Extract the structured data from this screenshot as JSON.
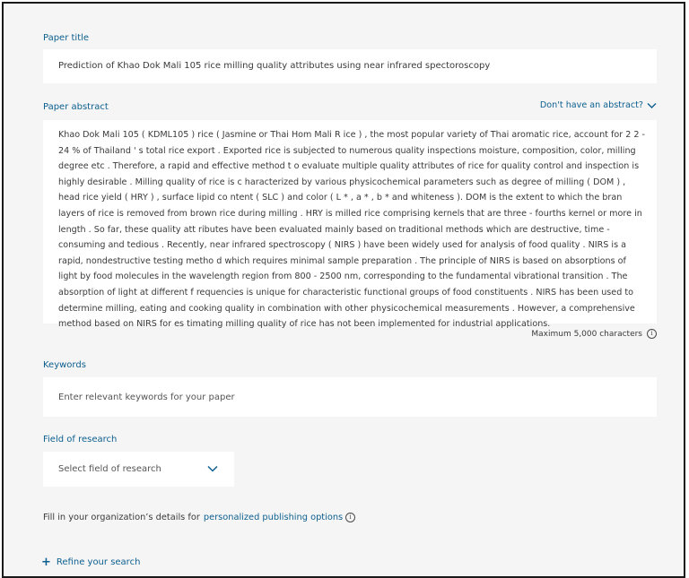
{
  "title_section": {
    "label": "Paper title",
    "value": "Prediction of Khao Dok Mali 105 rice milling quality attributes using near infrared spectoroscopy"
  },
  "abstract_section": {
    "label": "Paper abstract",
    "no_abstract_link": "Don't have an abstract?",
    "value": "Khao Dok Mali 105 ( KDML105 ) rice ( Jasmine or Thai Hom Mali R ice ) , the most popular variety of Thai aromatic rice, account for 2 2 - 24 % of Thailand ' s total rice export . Exported rice is subjected to numerous quality inspections moisture, composition, color, milling degree etc . Therefore, a rapid and effective method t o evaluate multiple quality attributes of rice for quality control and inspection is highly desirable . Milling quality of rice is c haracterized by various physicochemical parameters such as degree of milling ( DOM ) , head rice yield ( HRY ) , surface lipid co ntent ( SLC ) and color ( L * , a * , b * and whiteness ). DOM is the extent to which the bran layers of rice is removed from brown rice during milling . HRY is milled rice comprising kernels that are three - fourths kernel or more in length . So far, these quality att ributes have been evaluated mainly based on traditional methods which are destructive, time - consuming and tedious . Recently, near infrared spectroscopy ( NIRS ) have been widely used for analysis of food quality . NIRS is a rapid, nondestructive testing metho d which requires minimal sample preparation . The principle of NIRS is based on absorptions of light by food molecules in the wavelength region from 800 - 2500 nm, corresponding to the fundamental vibrational transition . The absorption of light at different f requencies is unique for characteristic functional groups of food constituents . NIRS has been used to determine milling, eating and cooking quality in combination with other physicochemical measurements . However, a comprehensive method based on NIRS for es timating milling quality of rice has not been implemented for industrial applications.",
    "max_chars": "Maximum 5,000 characters"
  },
  "keywords_section": {
    "label": "Keywords",
    "placeholder": "Enter relevant keywords for your paper"
  },
  "field_section": {
    "label": "Field of research",
    "selected": "Select field of research"
  },
  "org_prompt": {
    "text": "Fill in your organization’s details for",
    "link": "personalized publishing options"
  },
  "refine": {
    "label": "Refine your search"
  },
  "icons": [
    "chevron-down-icon",
    "info-icon",
    "plus-icon"
  ],
  "colors": {
    "accent": "#0c5f8f",
    "background": "#f5f5f5",
    "field": "#ffffff",
    "text": "#3a3a3a"
  }
}
